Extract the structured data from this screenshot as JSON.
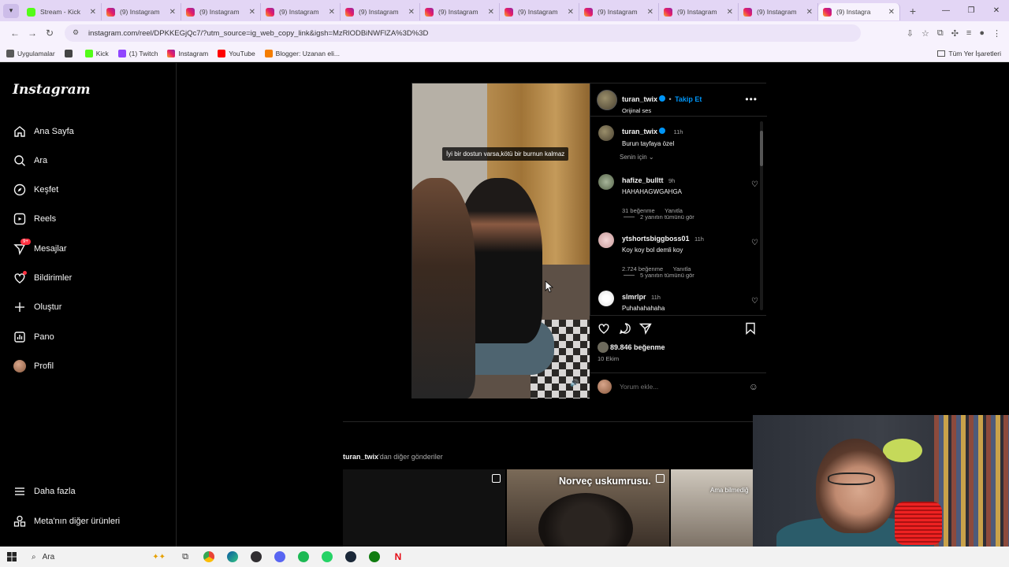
{
  "browser": {
    "tabs": [
      {
        "title": "Stream - Kick",
        "favicon": "kick-icon",
        "active": false
      },
      {
        "title": "(9) Instagram",
        "favicon": "instagram-icon",
        "active": false
      },
      {
        "title": "(9) Instagram",
        "favicon": "instagram-icon",
        "active": false
      },
      {
        "title": "(9) Instagram",
        "favicon": "instagram-icon",
        "active": false
      },
      {
        "title": "(9) Instagram",
        "favicon": "instagram-icon",
        "active": false
      },
      {
        "title": "(9) Instagram",
        "favicon": "instagram-icon",
        "active": false
      },
      {
        "title": "(9) Instagram",
        "favicon": "instagram-icon",
        "active": false
      },
      {
        "title": "(9) Instagram",
        "favicon": "instagram-icon",
        "active": false
      },
      {
        "title": "(9) Instagram",
        "favicon": "instagram-icon",
        "active": false
      },
      {
        "title": "(9) Instagram",
        "favicon": "instagram-icon",
        "active": false
      },
      {
        "title": "(9) Instagra",
        "favicon": "instagram-icon",
        "active": true
      }
    ],
    "url": "instagram.com/reel/DPKKEGjQc7/?utm_source=ig_web_copy_link&igsh=MzRlODBiNWFlZA%3D%3D",
    "bookmarks": [
      {
        "label": "Uygulamalar",
        "icon": "apps-icon"
      },
      {
        "label": "",
        "icon": "grid-icon"
      },
      {
        "label": "Kick",
        "icon": "kick-icon"
      },
      {
        "label": "(1) Twitch",
        "icon": "twitch-icon"
      },
      {
        "label": "Instagram",
        "icon": "instagram-icon"
      },
      {
        "label": "YouTube",
        "icon": "youtube-icon"
      },
      {
        "label": "Blogger: Uzanan eli...",
        "icon": "blogger-icon"
      }
    ],
    "bookmarks_right": "Tüm Yer İşaretleri"
  },
  "sidebar": {
    "logo": "Instagram",
    "items": [
      {
        "label": "Ana Sayfa",
        "icon": "home-icon"
      },
      {
        "label": "Ara",
        "icon": "search-icon"
      },
      {
        "label": "Keşfet",
        "icon": "compass-icon"
      },
      {
        "label": "Reels",
        "icon": "reels-icon"
      },
      {
        "label": "Mesajlar",
        "icon": "messenger-icon",
        "badge": "9+"
      },
      {
        "label": "Bildirimler",
        "icon": "heart-icon"
      },
      {
        "label": "Oluştur",
        "icon": "plus-icon"
      },
      {
        "label": "Pano",
        "icon": "dashboard-icon"
      },
      {
        "label": "Profil",
        "icon": "avatar"
      }
    ],
    "bottom": [
      {
        "label": "Daha fazla",
        "icon": "menu-icon"
      },
      {
        "label": "Meta'nın diğer ürünleri",
        "icon": "meta-apps-icon"
      }
    ]
  },
  "post": {
    "video_caption": "İyi bir dostun varsa,kötü bir burnun kalmaz",
    "author": "turan_twix",
    "follow": "Takip Et",
    "audio": "Orijinal ses",
    "caption_author": "turan_twix",
    "caption_time": "11h",
    "caption_text": "Burun tayfaya özel",
    "sort": "Senin için",
    "comments": [
      {
        "user": "hafize_bulltt",
        "time": "9h",
        "text": "HAHAHAGWGAHGA",
        "likes": "31 beğenme",
        "reply": "Yanıtla",
        "view_replies": "2 yanıtın tümünü gör"
      },
      {
        "user": "ytshortsbiggboss01",
        "time": "11h",
        "text": "Koy koy bol demli koy",
        "likes": "2.724 beğenme",
        "reply": "Yanıtla",
        "view_replies": "5 yanıtın tümünü gör"
      },
      {
        "user": "slmrlpr",
        "time": "11h",
        "text": "Puhahahahaha"
      }
    ],
    "likes": "89.846 beğenme",
    "date": "10 Ekim",
    "comment_placeholder": "Yorum ekle..."
  },
  "more_section": {
    "user": "turan_twix",
    "suffix": "'dan diğer gönderiler",
    "thumb_texts": [
      "Norveç uskumrusu.",
      "Ama bilmediğ"
    ]
  },
  "taskbar": {
    "search": "Ara"
  },
  "colors": {
    "accent": "#0095f6",
    "notification": "#ff3040",
    "chrome_bg": "#e3d6f5"
  }
}
